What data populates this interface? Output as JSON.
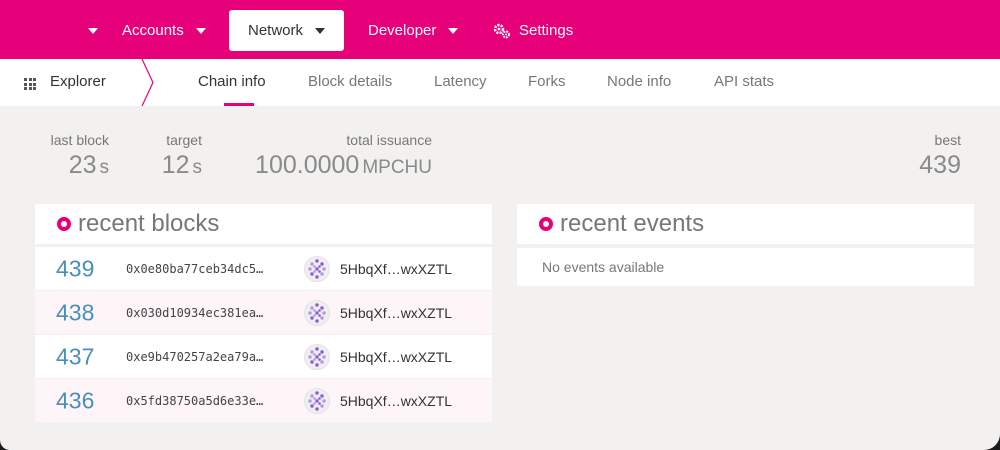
{
  "topnav": {
    "items": [
      {
        "label": ""
      },
      {
        "label": "Accounts"
      },
      {
        "label": "Network"
      },
      {
        "label": "Developer"
      },
      {
        "label": "Settings"
      }
    ]
  },
  "subnav": {
    "explorer_label": "Explorer",
    "tabs": [
      {
        "label": "Chain info"
      },
      {
        "label": "Block details"
      },
      {
        "label": "Latency"
      },
      {
        "label": "Forks"
      },
      {
        "label": "Node info"
      },
      {
        "label": "API stats"
      }
    ],
    "active_tab": "Chain info"
  },
  "summary": {
    "last_block": {
      "label": "last block",
      "value": "23",
      "unit": "s"
    },
    "target": {
      "label": "target",
      "value": "12",
      "unit": "s"
    },
    "total_issuance": {
      "label": "total issuance",
      "value": "100.0000",
      "unit": "MPCHU"
    },
    "best": {
      "label": "best",
      "value": "439"
    }
  },
  "recent_blocks": {
    "title": "recent blocks",
    "rows": [
      {
        "number": "439",
        "hash": "0x0e80ba77ceb34dc5…",
        "author": "5HbqXf…wxXZTL"
      },
      {
        "number": "438",
        "hash": "0x030d10934ec381ea…",
        "author": "5HbqXf…wxXZTL"
      },
      {
        "number": "437",
        "hash": "0xe9b470257a2ea79a…",
        "author": "5HbqXf…wxXZTL"
      },
      {
        "number": "436",
        "hash": "0x5fd38750a5d6e33e…",
        "author": "5HbqXf…wxXZTL"
      }
    ]
  },
  "recent_events": {
    "title": "recent events",
    "empty_text": "No events available"
  },
  "colors": {
    "accent": "#e6007a",
    "block_number": "#4a8fb8",
    "identicon": "#8e5bd6"
  }
}
